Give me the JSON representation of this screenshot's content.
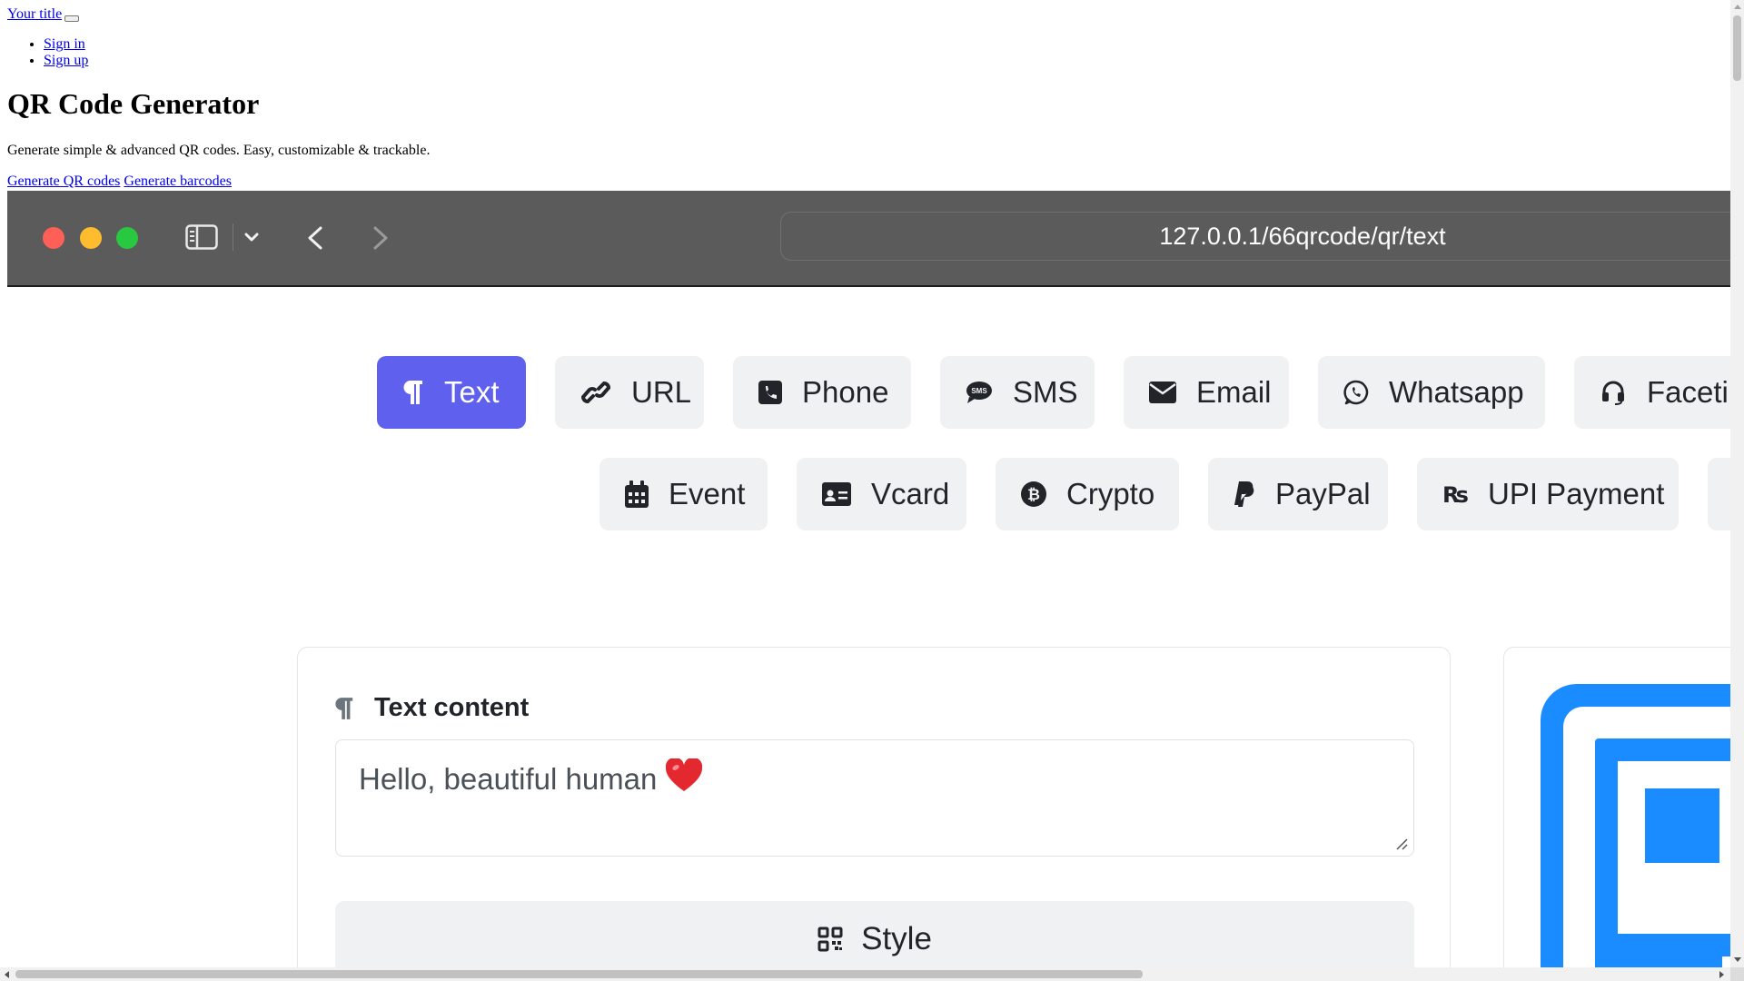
{
  "nav": {
    "title": "Your title",
    "sign_in": "Sign in",
    "sign_up": "Sign up"
  },
  "hero": {
    "title": "QR Code Generator",
    "subtitle": "Generate simple & advanced QR codes. Easy, customizable & trackable.",
    "link_qr": "Generate QR codes",
    "link_barcodes": "Generate barcodes"
  },
  "browser": {
    "url": "127.0.0.1/66qrcode/qr/text"
  },
  "types": {
    "row1": [
      {
        "label": "Text",
        "icon": "paragraph-icon",
        "active": true
      },
      {
        "label": "URL",
        "icon": "link-icon"
      },
      {
        "label": "Phone",
        "icon": "phone-icon"
      },
      {
        "label": "SMS",
        "icon": "sms-icon"
      },
      {
        "label": "Email",
        "icon": "envelope-icon"
      },
      {
        "label": "Whatsapp",
        "icon": "whatsapp-icon"
      },
      {
        "label": "Facetim",
        "icon": "headset-icon"
      }
    ],
    "row2": [
      {
        "label": "Event",
        "icon": "calendar-icon"
      },
      {
        "label": "Vcard",
        "icon": "id-card-icon"
      },
      {
        "label": "Crypto",
        "icon": "bitcoin-icon"
      },
      {
        "label": "PayPal",
        "icon": "paypal-icon"
      },
      {
        "label": "UPI Payment",
        "icon": "rupee-icon"
      }
    ]
  },
  "form": {
    "label": "Text content",
    "value": "Hello, beautiful human",
    "style_label": "Style"
  },
  "colors": {
    "accent": "#6060ef",
    "button_bg": "#f0f1f3",
    "qr_blue": "#1a8cff",
    "chrome_bg": "#5b5b5b"
  }
}
